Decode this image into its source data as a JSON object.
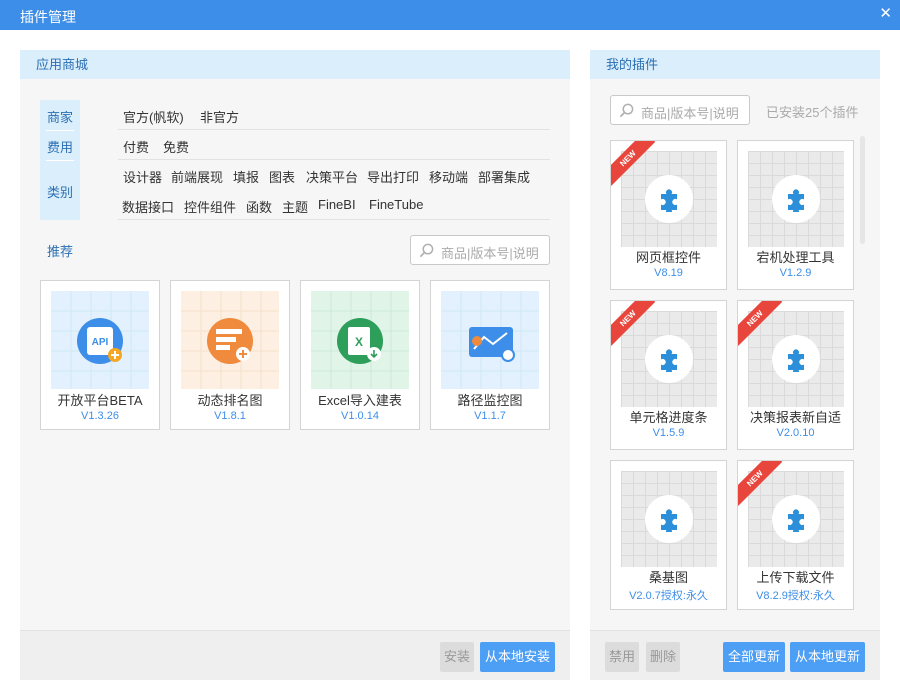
{
  "window": {
    "title": "插件管理"
  },
  "store": {
    "header": "应用商城",
    "filters": {
      "merchant": {
        "label": "商家",
        "options": [
          "官方(帆软)",
          "非官方"
        ]
      },
      "fee": {
        "label": "费用",
        "options": [
          "付费",
          "免费"
        ]
      },
      "category": {
        "label": "类别",
        "options": [
          "设计器",
          "前端展现",
          "填报",
          "图表",
          "决策平台",
          "导出打印",
          "移动端",
          "部署集成",
          "数据接口",
          "控件组件",
          "函数",
          "主题",
          "FineBI",
          "FineTube"
        ]
      }
    },
    "recommend_label": "推荐",
    "search_placeholder": "商品|版本号|说明",
    "cards": [
      {
        "name": "开放平台BETA",
        "version": "V1.3.26",
        "icon": "api-icon",
        "color": "#3d8ee8"
      },
      {
        "name": "动态排名图",
        "version": "V1.8.1",
        "icon": "ranking-chart-icon",
        "color": "#f08a3c"
      },
      {
        "name": "Excel导入建表",
        "version": "V1.0.14",
        "icon": "excel-import-icon",
        "color": "#2e9e5b"
      },
      {
        "name": "路径监控图",
        "version": "V1.1.7",
        "icon": "path-monitor-icon",
        "color": "#3d8ee8"
      }
    ],
    "footer": {
      "install": "安装",
      "install_local": "从本地安装"
    }
  },
  "mine": {
    "header": "我的插件",
    "search_placeholder": "商品|版本号|说明",
    "installed_count": "已安装25个插件",
    "new_badge": "NEW",
    "plugins": [
      {
        "name": "网页框控件",
        "version": "V8.19",
        "new": true
      },
      {
        "name": "宕机处理工具",
        "version": "V1.2.9",
        "new": false
      },
      {
        "name": "单元格进度条",
        "version": "V1.5.9",
        "new": true
      },
      {
        "name": "决策报表新自适",
        "version": "V2.0.10",
        "new": true
      },
      {
        "name": "桑基图",
        "version": "V2.0.7授权:永久",
        "new": false
      },
      {
        "name": "上传下载文件",
        "version": "V8.2.9授权:永久",
        "new": true
      }
    ],
    "footer": {
      "disable": "禁用",
      "delete": "删除",
      "update_all": "全部更新",
      "update_local": "从本地更新"
    }
  }
}
